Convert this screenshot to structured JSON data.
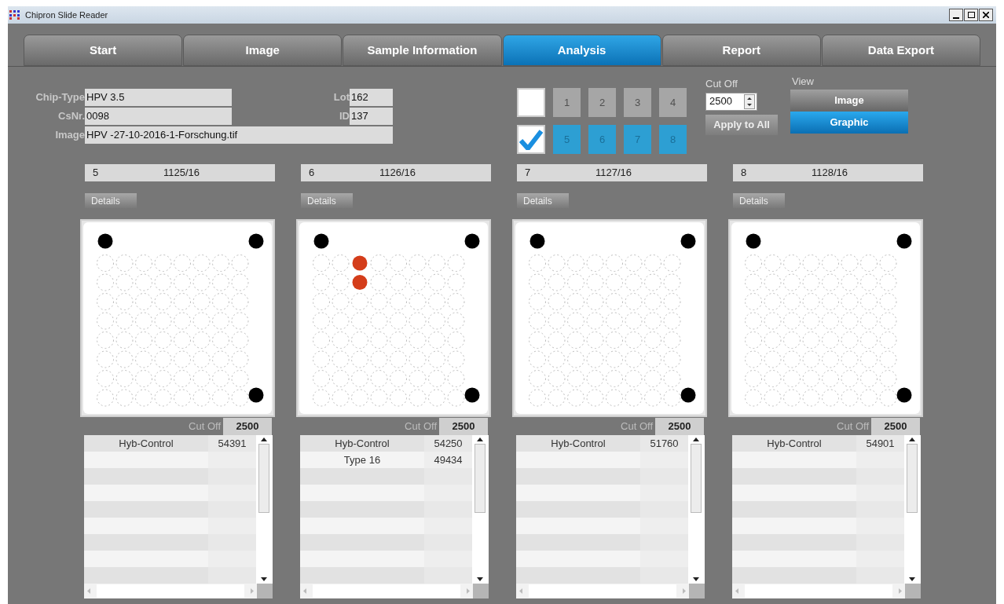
{
  "window": {
    "title": "Chipron Slide Reader"
  },
  "tabs": [
    {
      "label": "Start",
      "selected": false
    },
    {
      "label": "Image",
      "selected": false
    },
    {
      "label": "Sample Information",
      "selected": false
    },
    {
      "label": "Analysis",
      "selected": true
    },
    {
      "label": "Report",
      "selected": false
    },
    {
      "label": "Data Export",
      "selected": false
    }
  ],
  "info": {
    "left": [
      {
        "label": "Chip-Type",
        "value": "HPV 3.5"
      },
      {
        "label": "CsNr.",
        "value": "0098"
      }
    ],
    "right": [
      {
        "label": "Lot",
        "value": "162"
      },
      {
        "label": "ID",
        "value": "137"
      }
    ],
    "image": {
      "label": "Image",
      "value": "HPV -27-10-2016-1-Forschung.tif"
    }
  },
  "sample_groups": [
    {
      "checked": false,
      "samples": [
        {
          "label": "1",
          "selected": false
        },
        {
          "label": "2",
          "selected": false
        },
        {
          "label": "3",
          "selected": false
        },
        {
          "label": "4",
          "selected": false
        }
      ]
    },
    {
      "checked": true,
      "samples": [
        {
          "label": "5",
          "selected": true
        },
        {
          "label": "6",
          "selected": true
        },
        {
          "label": "7",
          "selected": true
        },
        {
          "label": "8",
          "selected": true
        }
      ]
    }
  ],
  "cut_off": {
    "label": "Cut Off",
    "value": "2500",
    "apply_button": "Apply to All"
  },
  "view": {
    "label": "View",
    "options": [
      {
        "label": "Image",
        "selected": false
      },
      {
        "label": "Graphic",
        "selected": true
      }
    ]
  },
  "panels": [
    {
      "number": "5",
      "code": "1125/16",
      "details": "Details",
      "spot_grid": [
        [
          false,
          false,
          false,
          false,
          false,
          false,
          false,
          false
        ],
        [
          false,
          false,
          false,
          false,
          false,
          false,
          false,
          false
        ],
        [
          false,
          false,
          false,
          false,
          false,
          false,
          false,
          false
        ],
        [
          false,
          false,
          false,
          false,
          false,
          false,
          false,
          false
        ],
        [
          false,
          false,
          false,
          false,
          false,
          false,
          false,
          false
        ],
        [
          false,
          false,
          false,
          false,
          false,
          false,
          false,
          false
        ],
        [
          false,
          false,
          false,
          false,
          false,
          false,
          false,
          false
        ],
        [
          false,
          false,
          false,
          false,
          false,
          false,
          false,
          false
        ]
      ],
      "cut_off_label": "Cut Off",
      "cut_off": "2500",
      "rows": [
        {
          "name": "Hyb-Control",
          "value": "54391"
        }
      ]
    },
    {
      "number": "6",
      "code": "1126/16",
      "details": "Details",
      "spot_grid": [
        [
          false,
          false,
          true,
          false,
          false,
          false,
          false,
          false
        ],
        [
          false,
          false,
          true,
          false,
          false,
          false,
          false,
          false
        ],
        [
          false,
          false,
          false,
          false,
          false,
          false,
          false,
          false
        ],
        [
          false,
          false,
          false,
          false,
          false,
          false,
          false,
          false
        ],
        [
          false,
          false,
          false,
          false,
          false,
          false,
          false,
          false
        ],
        [
          false,
          false,
          false,
          false,
          false,
          false,
          false,
          false
        ],
        [
          false,
          false,
          false,
          false,
          false,
          false,
          false,
          false
        ],
        [
          false,
          false,
          false,
          false,
          false,
          false,
          false,
          false
        ]
      ],
      "cut_off_label": "Cut Off",
      "cut_off": "2500",
      "rows": [
        {
          "name": "Hyb-Control",
          "value": "54250"
        },
        {
          "name": "Type 16",
          "value": "49434"
        }
      ]
    },
    {
      "number": "7",
      "code": "1127/16",
      "details": "Details",
      "spot_grid": [
        [
          false,
          false,
          false,
          false,
          false,
          false,
          false,
          false
        ],
        [
          false,
          false,
          false,
          false,
          false,
          false,
          false,
          false
        ],
        [
          false,
          false,
          false,
          false,
          false,
          false,
          false,
          false
        ],
        [
          false,
          false,
          false,
          false,
          false,
          false,
          false,
          false
        ],
        [
          false,
          false,
          false,
          false,
          false,
          false,
          false,
          false
        ],
        [
          false,
          false,
          false,
          false,
          false,
          false,
          false,
          false
        ],
        [
          false,
          false,
          false,
          false,
          false,
          false,
          false,
          false
        ],
        [
          false,
          false,
          false,
          false,
          false,
          false,
          false,
          false
        ]
      ],
      "cut_off_label": "Cut Off",
      "cut_off": "2500",
      "rows": [
        {
          "name": "Hyb-Control",
          "value": "51760"
        }
      ]
    },
    {
      "number": "8",
      "code": "1128/16",
      "details": "Details",
      "spot_grid": [
        [
          false,
          false,
          false,
          false,
          false,
          false,
          false,
          false
        ],
        [
          false,
          false,
          false,
          false,
          false,
          false,
          false,
          false
        ],
        [
          false,
          false,
          false,
          false,
          false,
          false,
          false,
          false
        ],
        [
          false,
          false,
          false,
          false,
          false,
          false,
          false,
          false
        ],
        [
          false,
          false,
          false,
          false,
          false,
          false,
          false,
          false
        ],
        [
          false,
          false,
          false,
          false,
          false,
          false,
          false,
          false
        ],
        [
          false,
          false,
          false,
          false,
          false,
          false,
          false,
          false
        ],
        [
          false,
          false,
          false,
          false,
          false,
          false,
          false,
          false
        ]
      ],
      "cut_off_label": "Cut Off",
      "cut_off": "2500",
      "rows": [
        {
          "name": "Hyb-Control",
          "value": "54901"
        }
      ]
    }
  ]
}
